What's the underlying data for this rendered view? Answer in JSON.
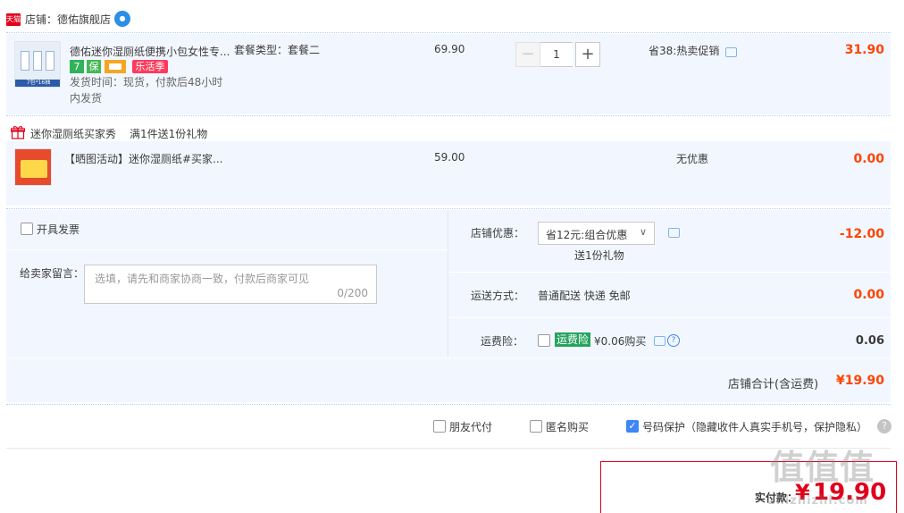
{
  "shop": {
    "badge": "天猫",
    "label": "店铺：德佑旗舰店",
    "ww_icon": "ww-chat-icon"
  },
  "item1": {
    "title": "德佑迷你湿厕纸便携小包女性专...",
    "sku": "套餐类型：套餐二",
    "badges": [
      "7",
      "保",
      "",
      "乐活季"
    ],
    "ship": "发货时间：现货，付款后48小时",
    "ship2": "内发货",
    "price": "69.90",
    "quantity": "1",
    "promo": "省38:热卖促销",
    "total": "31.90",
    "thumb_tag": "7包*16抽"
  },
  "gift": {
    "header_label": "迷你湿厕纸买家秀",
    "header_rule": "满1件送1份礼物",
    "title": "【晒图活动】迷你湿厕纸#买家...",
    "price": "59.00",
    "promo": "无优惠",
    "total": "0.00"
  },
  "settle": {
    "invoice_label": "开具发票",
    "message_label": "给卖家留言：",
    "message_placeholder": "选填，请先和商家协商一致，付款后商家可见",
    "message_count": "0/200",
    "shop_discount_label": "店铺优惠：",
    "shop_discount_value": "省12元:组合优惠",
    "gift_note": "送1份礼物",
    "shop_discount_amount": "-12.00",
    "shipping_label": "运送方式：",
    "shipping_value": "普通配送 快递 免邮",
    "shipping_amount": "0.00",
    "insurance_label": "运费险：",
    "insurance_tag": "运费险",
    "insurance_price": "¥0.06购买",
    "insurance_amount": "0.06",
    "shop_total_label": "店铺合计(含运费)",
    "shop_total_value": "¥19.90"
  },
  "options": {
    "friend_pay": "朋友代付",
    "anonymous": "匿名购买",
    "number_protect": "号码保护（隐藏收件人真实手机号，保护隐私）",
    "number_protect_checked": true
  },
  "pay": {
    "label": "实付款：",
    "amount": "19.90"
  },
  "watermark": {
    "line1": "值值值",
    "line2": "zhizhizhi.com"
  },
  "colors": {
    "accent": "#f40",
    "tmall_red": "#e0001b",
    "panel_bg": "#f2f7ff"
  }
}
